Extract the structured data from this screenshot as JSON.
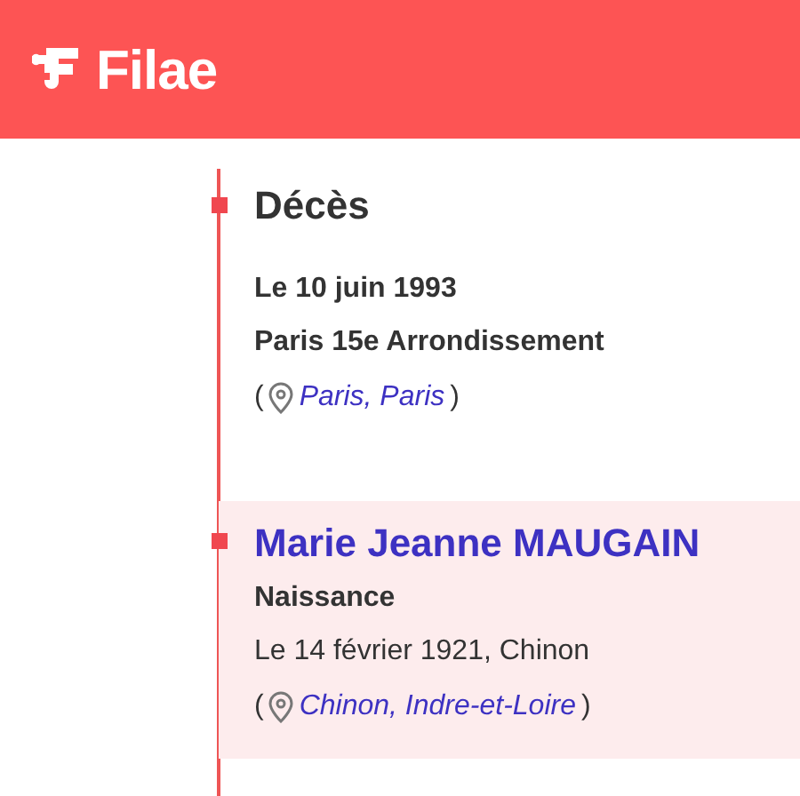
{
  "header": {
    "brand": "Filae"
  },
  "entries": [
    {
      "kind": "event",
      "highlighted": false,
      "title": "Décès",
      "lines": [
        "Le 10 juin 1993",
        "Paris 15e Arrondissement"
      ],
      "place": {
        "open": "(",
        "link": "Paris, Paris",
        "close": ")"
      }
    },
    {
      "kind": "person",
      "highlighted": true,
      "title": "Marie Jeanne MAUGAIN",
      "event": "Naissance",
      "lines": [
        "Le 14 février 1921, Chinon"
      ],
      "place": {
        "open": "(",
        "link": "Chinon, Indre-et-Loire",
        "close": ")"
      }
    }
  ]
}
